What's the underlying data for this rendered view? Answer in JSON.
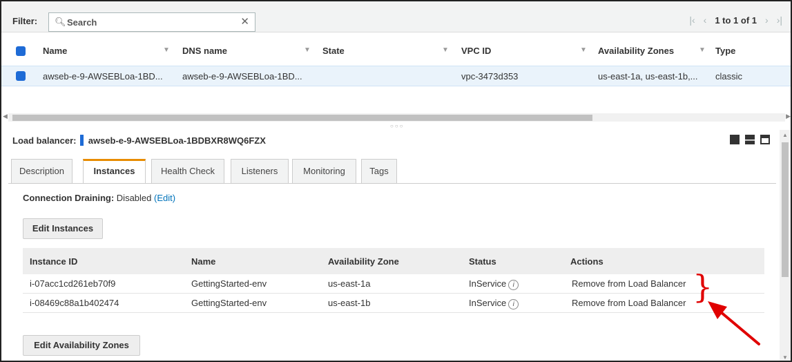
{
  "filter": {
    "label": "Filter:",
    "search_placeholder": "Search",
    "pagination": "1 to 1 of 1"
  },
  "table": {
    "columns": [
      "Name",
      "DNS name",
      "State",
      "VPC ID",
      "Availability Zones",
      "Type"
    ],
    "rows": [
      {
        "name": "awseb-e-9-AWSEBLoa-1BD...",
        "dns_name": "awseb-e-9-AWSEBLoa-1BD...",
        "state": "",
        "vpc_id": "vpc-3473d353",
        "availability_zones": "us-east-1a, us-east-1b,...",
        "type": "classic"
      }
    ]
  },
  "detail": {
    "label": "Load balancer:",
    "name": "awseb-e-9-AWSEBLoa-1BDBXR8WQ6FZX",
    "tabs": [
      "Description",
      "Instances",
      "Health Check",
      "Listeners",
      "Monitoring",
      "Tags"
    ],
    "active_tab": "Instances",
    "connection_draining": {
      "label": "Connection Draining:",
      "value": "Disabled",
      "edit": "(Edit)"
    },
    "edit_instances_button": "Edit Instances",
    "edit_az_button": "Edit Availability Zones",
    "instances": {
      "columns": [
        "Instance ID",
        "Name",
        "Availability Zone",
        "Status",
        "Actions"
      ],
      "rows": [
        {
          "id": "i-07acc1cd261eb70f9",
          "name": "GettingStarted-env",
          "zone": "us-east-1a",
          "status": "InService",
          "action": "Remove from Load Balancer"
        },
        {
          "id": "i-08469c88a1b402474",
          "name": "GettingStarted-env",
          "zone": "us-east-1b",
          "status": "InService",
          "action": "Remove from Load Balancer"
        }
      ]
    }
  },
  "annotation": {
    "color": "#e00000"
  },
  "colors": {
    "accent_blue": "#1e6bd6",
    "link": "#0073bb",
    "tab_active": "#e88c00"
  }
}
